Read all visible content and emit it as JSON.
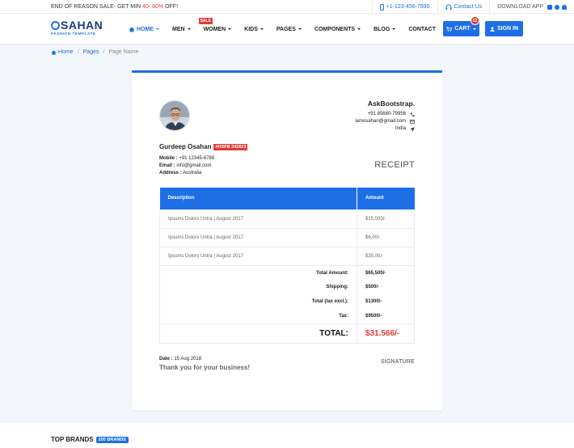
{
  "topbar": {
    "promo_prefix": "END OF REASON SALE- GET MIN ",
    "promo_highlight": "40- 80%",
    "promo_suffix": " OFF!",
    "phone": "+1-123-456-7890",
    "contact": "Contact Us",
    "download": "DOWNLOAD APP"
  },
  "logo": {
    "name": "SAHAN",
    "tagline": "FASHION TEMPLATE"
  },
  "nav": {
    "home": "HOME",
    "men": "MEN",
    "women": "WOMEN",
    "women_badge": "SALE",
    "kids": "KIDS",
    "pages": "PAGES",
    "components": "COMPONENTS",
    "blog": "BLOG",
    "contact": "CONTACT",
    "cart": "CART",
    "cart_count": "02",
    "signin": "SIGN IN"
  },
  "breadcrumb": {
    "home": "Home",
    "pages": "Pages",
    "current": "Page Name"
  },
  "customer": {
    "name": "Gurdeep Osahan",
    "id_tag": "#HSFB 342823",
    "mobile_label": "Mobile :",
    "mobile": " +91 12345-6789",
    "email_label": "Email :",
    "email": " info@gmail.com",
    "address_label": "Address :",
    "address": " Australia"
  },
  "company": {
    "name": "AskBootstrap.",
    "phone": "+91 85680-79956",
    "email": "iamosahan@gmail.com",
    "country": "India"
  },
  "receipt_title": "RECEIPT",
  "table": {
    "col_description": "Description",
    "col_amount": "Amount",
    "rows": [
      {
        "desc": "Ipsums Dolors Untra | August 2017",
        "amount": "$15,000/-"
      },
      {
        "desc": "Ipsums Dolors Untra | August 2017",
        "amount": "$6,00/-"
      },
      {
        "desc": "Ipsums Dolors Untra | August 2017",
        "amount": "$35,00/-"
      }
    ],
    "totals": [
      {
        "label": "Total Amount:",
        "value": "$65,500/-"
      },
      {
        "label": "Shipping:",
        "value": "$500/-"
      },
      {
        "label": "Total (tax excl.):",
        "value": "$1300/-"
      },
      {
        "label": "Tax:",
        "value": "$9500/-"
      }
    ],
    "grand_label": "TOTAL:",
    "grand_value": "$31.566/-"
  },
  "footer": {
    "date_label": "Date :",
    "date": " 15 Aug 2018",
    "thanks": "Thank you for your business!",
    "signature": "SIGNATURE"
  },
  "brands": {
    "title": "TOP BRANDS",
    "badge": "200 BRANDS"
  },
  "colors": {
    "primary": "#1e6fe6",
    "danger": "#e53935",
    "background": "#f3f6fb"
  }
}
